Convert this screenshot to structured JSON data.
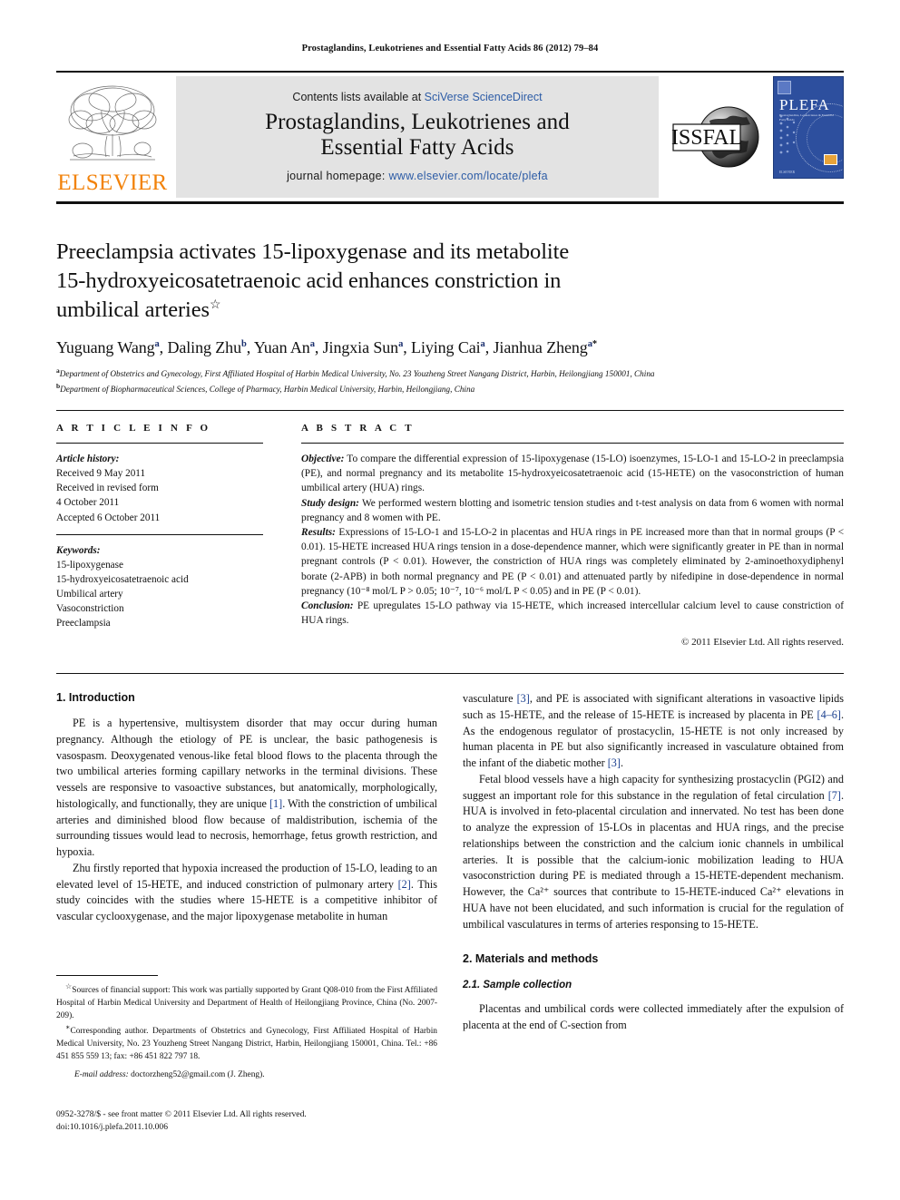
{
  "running_head": "Prostaglandins, Leukotrienes and Essential Fatty Acids 86 (2012) 79–84",
  "masthead": {
    "publisher_logo_text": "ELSEVIER",
    "publisher_logo_color": "#f2820a",
    "contents_prefix": "Contents lists available at ",
    "contents_link": "SciVerse ScienceDirect",
    "journal_title_line1": "Prostaglandins, Leukotrienes and",
    "journal_title_line2": "Essential Fatty Acids",
    "homepage_prefix": "journal homepage: ",
    "homepage_url": "www.elsevier.com/locate/plefa",
    "society_logo_text": "ISSFAL",
    "cover": {
      "title": "PLEFA",
      "subtitle": "Prostaglandins, Leukotrienes & Essential Fatty Acids",
      "blurb": "Official Journal of the International Society for the Study of Fatty Acids and Lipids (ISSFAL)",
      "footer": "ELSEVIER",
      "background": "#2d4f9e"
    },
    "link_color": "#2d5ca6"
  },
  "article": {
    "title_line1": "Preeclampsia activates 15-lipoxygenase and its metabolite",
    "title_line2": "15-hydroxyeicosatetraenoic acid enhances constriction in",
    "title_line3": "umbilical arteries",
    "title_footnote_symbol": "☆",
    "authors": [
      {
        "name": "Yuguang Wang",
        "sup": "a"
      },
      {
        "name": "Daling Zhu",
        "sup": "b"
      },
      {
        "name": "Yuan An",
        "sup": "a"
      },
      {
        "name": "Jingxia Sun",
        "sup": "a"
      },
      {
        "name": "Liying Cai",
        "sup": "a"
      },
      {
        "name": "Jianhua Zheng",
        "sup": "a",
        "corresponding": "*"
      }
    ],
    "affiliations": [
      {
        "mark": "a",
        "text": "Department of Obstetrics and Gynecology, First Affiliated Hospital of Harbin Medical University, No. 23 Youzheng Street Nangang District, Harbin, Heilongjiang 150001, China"
      },
      {
        "mark": "b",
        "text": "Department of Biopharmaceutical Sciences, College of Pharmacy, Harbin Medical University, Harbin, Heilongjiang, China"
      }
    ]
  },
  "article_info": {
    "heading": "A R T I C L E   I N F O",
    "history_label": "Article history:",
    "history": [
      "Received 9 May 2011",
      "Received in revised form",
      "4 October 2011",
      "Accepted 6 October 2011"
    ],
    "keywords_label": "Keywords:",
    "keywords": [
      "15-lipoxygenase",
      "15-hydroxyeicosatetraenoic acid",
      "Umbilical artery",
      "Vasoconstriction",
      "Preeclampsia"
    ]
  },
  "abstract": {
    "heading": "A B S T R A C T",
    "sections": [
      {
        "label": "Objective:",
        "text": " To compare the differential expression of 15-lipoxygenase (15-LO) isoenzymes, 15-LO-1 and 15-LO-2 in preeclampsia (PE), and normal pregnancy and its metabolite 15-hydroxyeicosatetraenoic acid (15-HETE) on the vasoconstriction of human umbilical artery (HUA) rings."
      },
      {
        "label": "Study design:",
        "text": " We performed western blotting and isometric tension studies and t-test analysis on data from 6 women with normal pregnancy and 8 women with PE."
      },
      {
        "label": "Results:",
        "text": " Expressions of 15-LO-1 and 15-LO-2 in placentas and HUA rings in PE increased more than that in normal groups (P < 0.01). 15-HETE increased HUA rings tension in a dose-dependence manner, which were significantly greater in PE than in normal pregnant controls (P < 0.01). However, the constriction of HUA rings was completely eliminated by 2-aminoethoxydiphenyl borate (2-APB) in both normal pregnancy and PE (P < 0.01) and attenuated partly by nifedipine in dose-dependence in normal pregnancy (10⁻⁸ mol/L P > 0.05; 10⁻⁷, 10⁻⁶ mol/L P < 0.05) and in PE (P < 0.01)."
      },
      {
        "label": "Conclusion:",
        "text": " PE upregulates 15-LO pathway via 15-HETE, which increased intercellular calcium level to cause constriction of HUA rings."
      }
    ],
    "copyright": "© 2011 Elsevier Ltd. All rights reserved."
  },
  "body": {
    "section1_heading": "1.  Introduction",
    "left_paragraphs": [
      "PE is a hypertensive, multisystem disorder that may occur during human pregnancy. Although the etiology of PE is unclear, the basic pathogenesis is vasospasm. Deoxygenated venous-like fetal blood flows to the placenta through the two umbilical arteries forming capillary networks in the terminal divisions. These vessels are responsive to vasoactive substances, but anatomically, morphologically, histologically, and functionally, they are unique [1]. With the constriction of umbilical arteries and diminished blood flow because of maldistribution, ischemia of the surrounding tissues would lead to necrosis, hemorrhage, fetus growth restriction, and hypoxia.",
      "Zhu firstly reported that hypoxia increased the production of 15-LO, leading to an elevated level of 15-HETE, and induced constriction of pulmonary artery [2]. This study coincides with the studies where 15-HETE is a competitive inhibitor of vascular cyclooxygenase, and the major lipoxygenase metabolite in human"
    ],
    "right_paragraphs": [
      "vasculature [3], and PE is associated with significant alterations in vasoactive lipids such as 15-HETE, and the release of 15-HETE is increased by placenta in PE [4–6]. As the endogenous regulator of prostacyclin, 15-HETE is not only increased by human placenta in PE but also significantly increased in vasculature obtained from the infant of the diabetic mother [3].",
      "Fetal blood vessels have a high capacity for synthesizing prostacyclin (PGI2) and suggest an important role for this substance in the regulation of fetal circulation [7]. HUA is involved in feto-placental circulation and innervated. No test has been done to analyze the expression of 15-LOs in placentas and HUA rings, and the precise relationships between the constriction and the calcium ionic channels in umbilical arteries. It is possible that the calcium-ionic mobilization leading to HUA vasoconstriction during PE is mediated through a 15-HETE-dependent mechanism. However, the Ca²⁺ sources that contribute to 15-HETE-induced Ca²⁺ elevations in HUA have not been elucidated, and such information is crucial for the regulation of umbilical vasculatures in terms of arteries responsing to 15-HETE."
    ],
    "section2_heading": "2.  Materials and methods",
    "subsection21_heading": "2.1.  Sample collection",
    "section2_paragraph": "Placentas and umbilical cords were collected immediately after the expulsion of placenta at the end of C-section from",
    "reference_link_color": "#1a3f8f"
  },
  "footnotes": {
    "funding_symbol": "☆",
    "funding_text": "Sources of financial support: This work was partially supported by Grant Q08-010 from the First Affiliated Hospital of Harbin Medical University and Department of Health of Heilongjiang Province, China (No. 2007-209).",
    "corresponding_symbol": "∗",
    "corresponding_text": "Corresponding author. Departments of Obstetrics and Gynecology, First Affiliated Hospital of Harbin Medical University, No. 23 Youzheng Street Nangang District, Harbin, Heilongjiang 150001, China. Tel.: +86 451 855 559 13; fax: +86 451 822 797 18.",
    "email_label": "E-mail address:",
    "email_value": " doctorzheng52@gmail.com (J. Zheng)."
  },
  "imprint": {
    "line1": "0952-3278/$ - see front matter © 2011 Elsevier Ltd. All rights reserved.",
    "line2": "doi:10.1016/j.plefa.2011.10.006"
  }
}
